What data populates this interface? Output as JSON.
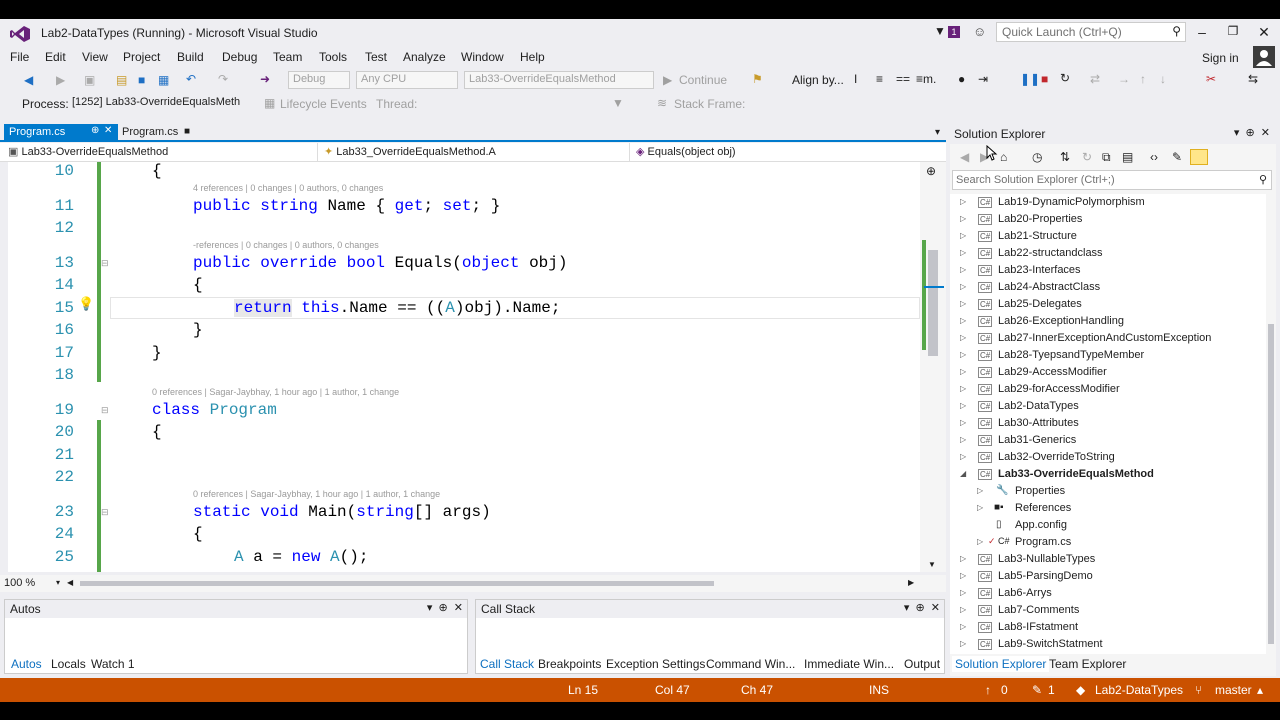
{
  "title": "Lab2-DataTypes (Running) - Microsoft Visual Studio",
  "notification_count": "1",
  "quick_launch_placeholder": "Quick Launch (Ctrl+Q)",
  "menu": [
    "File",
    "Edit",
    "View",
    "Project",
    "Build",
    "Debug",
    "Team",
    "Tools",
    "Test",
    "Analyze",
    "Window",
    "Help"
  ],
  "sign_in": "Sign in",
  "toolbar1": {
    "config": "Debug",
    "platform": "Any CPU",
    "startup": "Lab33-OverrideEqualsMethod",
    "continue": "Continue",
    "align": "Align by..."
  },
  "toolbar2": {
    "process_label": "Process:",
    "process_value": "[1252] Lab33-OverrideEqualsMeth",
    "lifecycle": "Lifecycle Events",
    "thread_label": "Thread:",
    "stack_frame": "Stack Frame:"
  },
  "tabs": {
    "active": "Program.cs",
    "inactive": "Program.cs"
  },
  "nav": {
    "project": "Lab33-OverrideEqualsMethod",
    "type": "Lab33_OverrideEqualsMethod.A",
    "member": "Equals(object obj)"
  },
  "code": {
    "l10": "{",
    "lens11": "4 references | 0 changes | 0 authors, 0 changes",
    "l11_kw1": "public",
    "l11_kw2": "string",
    "l11_rest": "Name { ",
    "l11_get": "get",
    "l11_sep": "; ",
    "l11_set": "set",
    "l11_end": "; }",
    "lens13": "-references | 0 changes | 0 authors, 0 changes",
    "l13_kw": "public override bool",
    "l13_rest": "Equals(",
    "l13_obj": "object",
    "l13_end": "obj)",
    "l14": "{",
    "l15_ret": "return",
    "l15_this": "this",
    "l15_mid": ".Name == ((",
    "l15_A": "A",
    "l15_end": ")obj).Name;",
    "l16": "}",
    "l17": "}",
    "lens19": "0 references | Sagar-Jaybhay, 1 hour ago | 1 author, 1 change",
    "l19_kw": "class",
    "l19_name": "Program",
    "l20": "{",
    "lens23": "0 references | Sagar-Jaybhay, 1 hour ago | 1 author, 1 change",
    "l23_kw": "static void",
    "l23_main": "Main(",
    "l23_string": "string",
    "l23_end": "[] args)",
    "l24": "{",
    "l25_A": "A",
    "l25_a": " a = ",
    "l25_new": "new",
    "l25_A2": "A",
    "l25_end": "();",
    "line_numbers": [
      "10",
      "11",
      "12",
      "13",
      "14",
      "15",
      "16",
      "17",
      "18",
      "19",
      "20",
      "21",
      "22",
      "23",
      "24",
      "25"
    ]
  },
  "zoom": "100 %",
  "panels": {
    "autos": "Autos",
    "callstack": "Call Stack",
    "left_tabs": [
      "Autos",
      "Locals",
      "Watch 1"
    ],
    "right_tabs": [
      "Call Stack",
      "Breakpoints",
      "Exception Settings",
      "Command Win...",
      "Immediate Win...",
      "Output"
    ]
  },
  "solution": {
    "title": "Solution Explorer",
    "search_placeholder": "Search Solution Explorer (Ctrl+;)",
    "items": [
      "Lab19-DynamicPolymorphism",
      "Lab20-Properties",
      "Lab21-Structure",
      "Lab22-structandclass",
      "Lab23-Interfaces",
      "Lab24-AbstractClass",
      "Lab25-Delegates",
      "Lab26-ExceptionHandling",
      "Lab27-InnerExceptionAndCustomException",
      "Lab28-TyepsandTypeMember",
      "Lab29-AccessModifier",
      "Lab29-forAccessModifier",
      "Lab2-DataTypes",
      "Lab30-Attributes",
      "Lab31-Generics",
      "Lab32-OverrideToString",
      "Lab33-OverrideEqualsMethod"
    ],
    "children": [
      "Properties",
      "References",
      "App.config",
      "Program.cs"
    ],
    "items_after": [
      "Lab3-NullableTypes",
      "Lab5-ParsingDemo",
      "Lab6-Arrys",
      "Lab7-Comments",
      "Lab8-IFstatment",
      "Lab9-SwitchStatment"
    ],
    "tabs": [
      "Solution Explorer",
      "Team Explorer"
    ]
  },
  "status": {
    "ln": "Ln 15",
    "col": "Col 47",
    "ch": "Ch 47",
    "ins": "INS",
    "up": "0",
    "edits": "1",
    "repo": "Lab2-DataTypes",
    "branch": "master"
  },
  "colors": {
    "accent": "#007acc",
    "status": "#ca5100",
    "keyword": "#0000ff",
    "type": "#2b91af"
  }
}
